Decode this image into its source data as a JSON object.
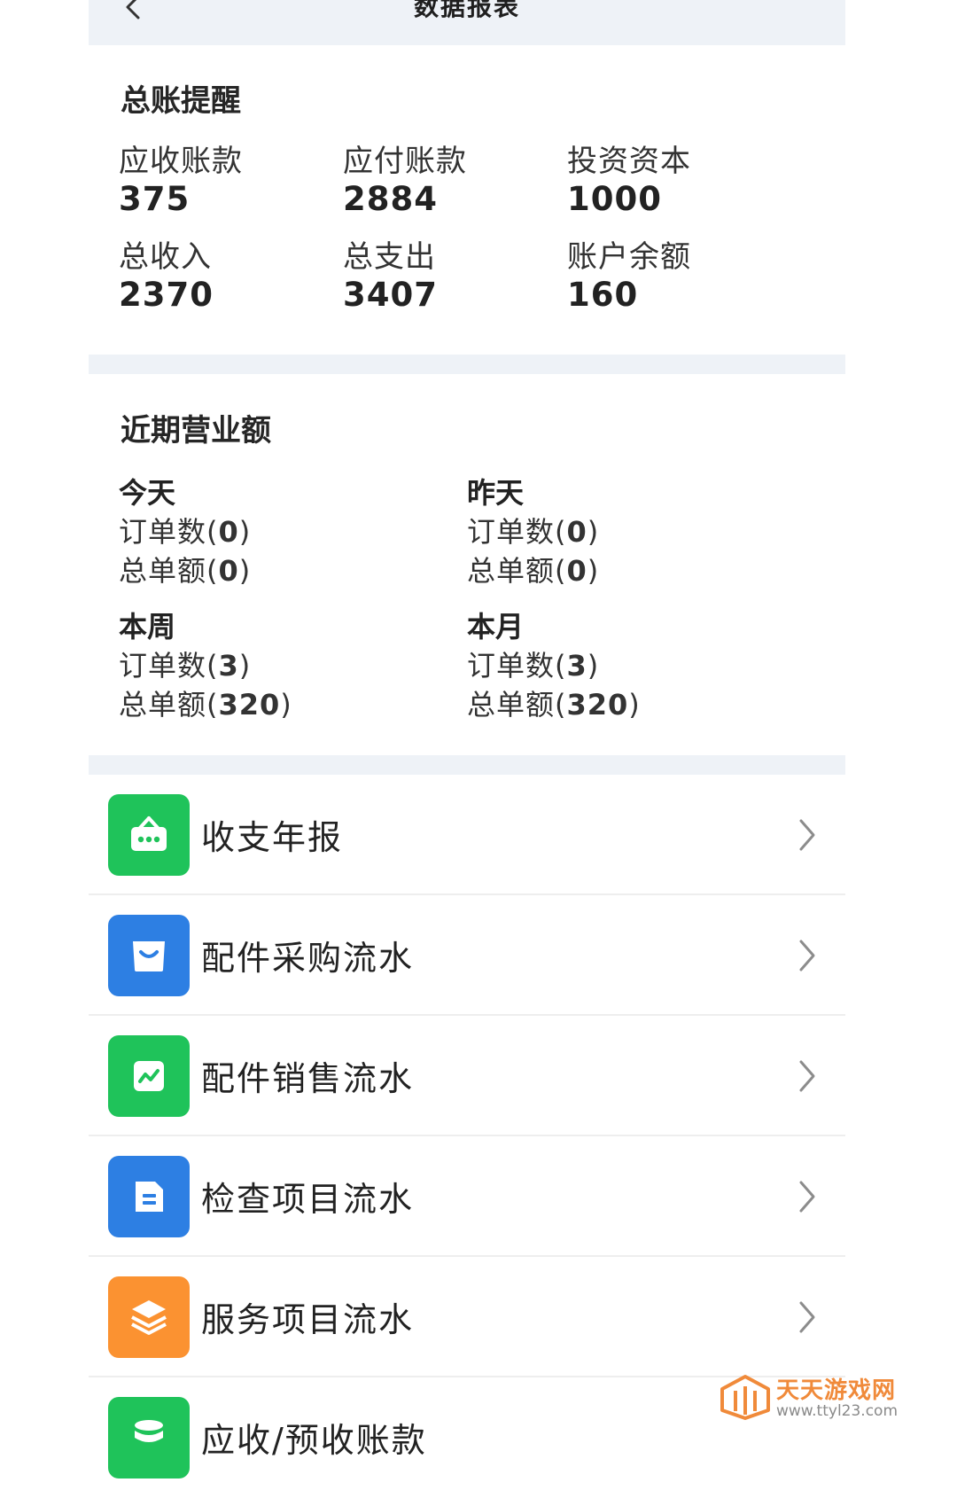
{
  "header": {
    "title": "数据报表"
  },
  "ledger": {
    "title": "总账提醒",
    "items": [
      {
        "label": "应收账款",
        "value": "375"
      },
      {
        "label": "应付账款",
        "value": "2884"
      },
      {
        "label": "投资资本",
        "value": "1000"
      },
      {
        "label": "总收入",
        "value": "2370"
      },
      {
        "label": "总支出",
        "value": "3407"
      },
      {
        "label": "账户余额",
        "value": "160"
      }
    ]
  },
  "revenue": {
    "title": "近期营业额",
    "periods": [
      {
        "name": "今天",
        "orders_label": "订单数",
        "orders": "0",
        "amount_label": "总单额",
        "amount": "0"
      },
      {
        "name": "昨天",
        "orders_label": "订单数",
        "orders": "0",
        "amount_label": "总单额",
        "amount": "0"
      },
      {
        "name": "本周",
        "orders_label": "订单数",
        "orders": "3",
        "amount_label": "总单额",
        "amount": "320"
      },
      {
        "name": "本月",
        "orders_label": "订单数",
        "orders": "3",
        "amount_label": "总单额",
        "amount": "320"
      }
    ]
  },
  "menu": [
    {
      "label": "收支年报",
      "icon": "shopping-bag-icon",
      "color": "#1fc35a"
    },
    {
      "label": "配件采购流水",
      "icon": "bag-icon",
      "color": "#2d7fe3"
    },
    {
      "label": "配件销售流水",
      "icon": "trend-chart-icon",
      "color": "#1fc35a"
    },
    {
      "label": "检查项目流水",
      "icon": "document-icon",
      "color": "#2d7fe3"
    },
    {
      "label": "服务项目流水",
      "icon": "layers-icon",
      "color": "#fb9231"
    },
    {
      "label": "应收/预收账款",
      "icon": "database-icon",
      "color": "#1fc35a"
    }
  ],
  "watermark": {
    "title": "天天游戏网",
    "url": "www.ttyl23.com"
  }
}
